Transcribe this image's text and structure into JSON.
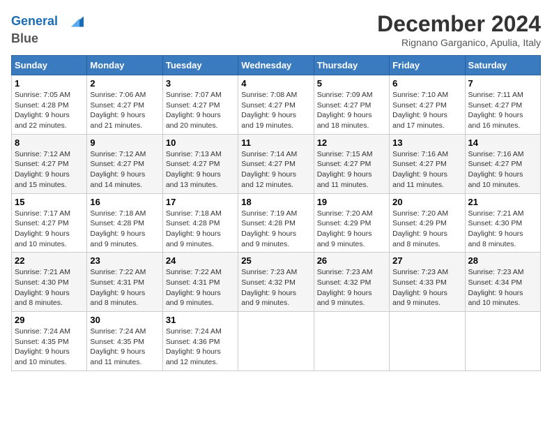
{
  "header": {
    "logo_line1": "General",
    "logo_line2": "Blue",
    "month": "December 2024",
    "location": "Rignano Garganico, Apulia, Italy"
  },
  "days_of_week": [
    "Sunday",
    "Monday",
    "Tuesday",
    "Wednesday",
    "Thursday",
    "Friday",
    "Saturday"
  ],
  "weeks": [
    [
      {
        "day": "1",
        "info": "Sunrise: 7:05 AM\nSunset: 4:28 PM\nDaylight: 9 hours\nand 22 minutes."
      },
      {
        "day": "2",
        "info": "Sunrise: 7:06 AM\nSunset: 4:27 PM\nDaylight: 9 hours\nand 21 minutes."
      },
      {
        "day": "3",
        "info": "Sunrise: 7:07 AM\nSunset: 4:27 PM\nDaylight: 9 hours\nand 20 minutes."
      },
      {
        "day": "4",
        "info": "Sunrise: 7:08 AM\nSunset: 4:27 PM\nDaylight: 9 hours\nand 19 minutes."
      },
      {
        "day": "5",
        "info": "Sunrise: 7:09 AM\nSunset: 4:27 PM\nDaylight: 9 hours\nand 18 minutes."
      },
      {
        "day": "6",
        "info": "Sunrise: 7:10 AM\nSunset: 4:27 PM\nDaylight: 9 hours\nand 17 minutes."
      },
      {
        "day": "7",
        "info": "Sunrise: 7:11 AM\nSunset: 4:27 PM\nDaylight: 9 hours\nand 16 minutes."
      }
    ],
    [
      {
        "day": "8",
        "info": "Sunrise: 7:12 AM\nSunset: 4:27 PM\nDaylight: 9 hours\nand 15 minutes."
      },
      {
        "day": "9",
        "info": "Sunrise: 7:12 AM\nSunset: 4:27 PM\nDaylight: 9 hours\nand 14 minutes."
      },
      {
        "day": "10",
        "info": "Sunrise: 7:13 AM\nSunset: 4:27 PM\nDaylight: 9 hours\nand 13 minutes."
      },
      {
        "day": "11",
        "info": "Sunrise: 7:14 AM\nSunset: 4:27 PM\nDaylight: 9 hours\nand 12 minutes."
      },
      {
        "day": "12",
        "info": "Sunrise: 7:15 AM\nSunset: 4:27 PM\nDaylight: 9 hours\nand 11 minutes."
      },
      {
        "day": "13",
        "info": "Sunrise: 7:16 AM\nSunset: 4:27 PM\nDaylight: 9 hours\nand 11 minutes."
      },
      {
        "day": "14",
        "info": "Sunrise: 7:16 AM\nSunset: 4:27 PM\nDaylight: 9 hours\nand 10 minutes."
      }
    ],
    [
      {
        "day": "15",
        "info": "Sunrise: 7:17 AM\nSunset: 4:27 PM\nDaylight: 9 hours\nand 10 minutes."
      },
      {
        "day": "16",
        "info": "Sunrise: 7:18 AM\nSunset: 4:28 PM\nDaylight: 9 hours\nand 9 minutes."
      },
      {
        "day": "17",
        "info": "Sunrise: 7:18 AM\nSunset: 4:28 PM\nDaylight: 9 hours\nand 9 minutes."
      },
      {
        "day": "18",
        "info": "Sunrise: 7:19 AM\nSunset: 4:28 PM\nDaylight: 9 hours\nand 9 minutes."
      },
      {
        "day": "19",
        "info": "Sunrise: 7:20 AM\nSunset: 4:29 PM\nDaylight: 9 hours\nand 9 minutes."
      },
      {
        "day": "20",
        "info": "Sunrise: 7:20 AM\nSunset: 4:29 PM\nDaylight: 9 hours\nand 8 minutes."
      },
      {
        "day": "21",
        "info": "Sunrise: 7:21 AM\nSunset: 4:30 PM\nDaylight: 9 hours\nand 8 minutes."
      }
    ],
    [
      {
        "day": "22",
        "info": "Sunrise: 7:21 AM\nSunset: 4:30 PM\nDaylight: 9 hours\nand 8 minutes."
      },
      {
        "day": "23",
        "info": "Sunrise: 7:22 AM\nSunset: 4:31 PM\nDaylight: 9 hours\nand 8 minutes."
      },
      {
        "day": "24",
        "info": "Sunrise: 7:22 AM\nSunset: 4:31 PM\nDaylight: 9 hours\nand 9 minutes."
      },
      {
        "day": "25",
        "info": "Sunrise: 7:23 AM\nSunset: 4:32 PM\nDaylight: 9 hours\nand 9 minutes."
      },
      {
        "day": "26",
        "info": "Sunrise: 7:23 AM\nSunset: 4:32 PM\nDaylight: 9 hours\nand 9 minutes."
      },
      {
        "day": "27",
        "info": "Sunrise: 7:23 AM\nSunset: 4:33 PM\nDaylight: 9 hours\nand 9 minutes."
      },
      {
        "day": "28",
        "info": "Sunrise: 7:23 AM\nSunset: 4:34 PM\nDaylight: 9 hours\nand 10 minutes."
      }
    ],
    [
      {
        "day": "29",
        "info": "Sunrise: 7:24 AM\nSunset: 4:35 PM\nDaylight: 9 hours\nand 10 minutes."
      },
      {
        "day": "30",
        "info": "Sunrise: 7:24 AM\nSunset: 4:35 PM\nDaylight: 9 hours\nand 11 minutes."
      },
      {
        "day": "31",
        "info": "Sunrise: 7:24 AM\nSunset: 4:36 PM\nDaylight: 9 hours\nand 12 minutes."
      },
      {
        "day": "",
        "info": ""
      },
      {
        "day": "",
        "info": ""
      },
      {
        "day": "",
        "info": ""
      },
      {
        "day": "",
        "info": ""
      }
    ]
  ]
}
